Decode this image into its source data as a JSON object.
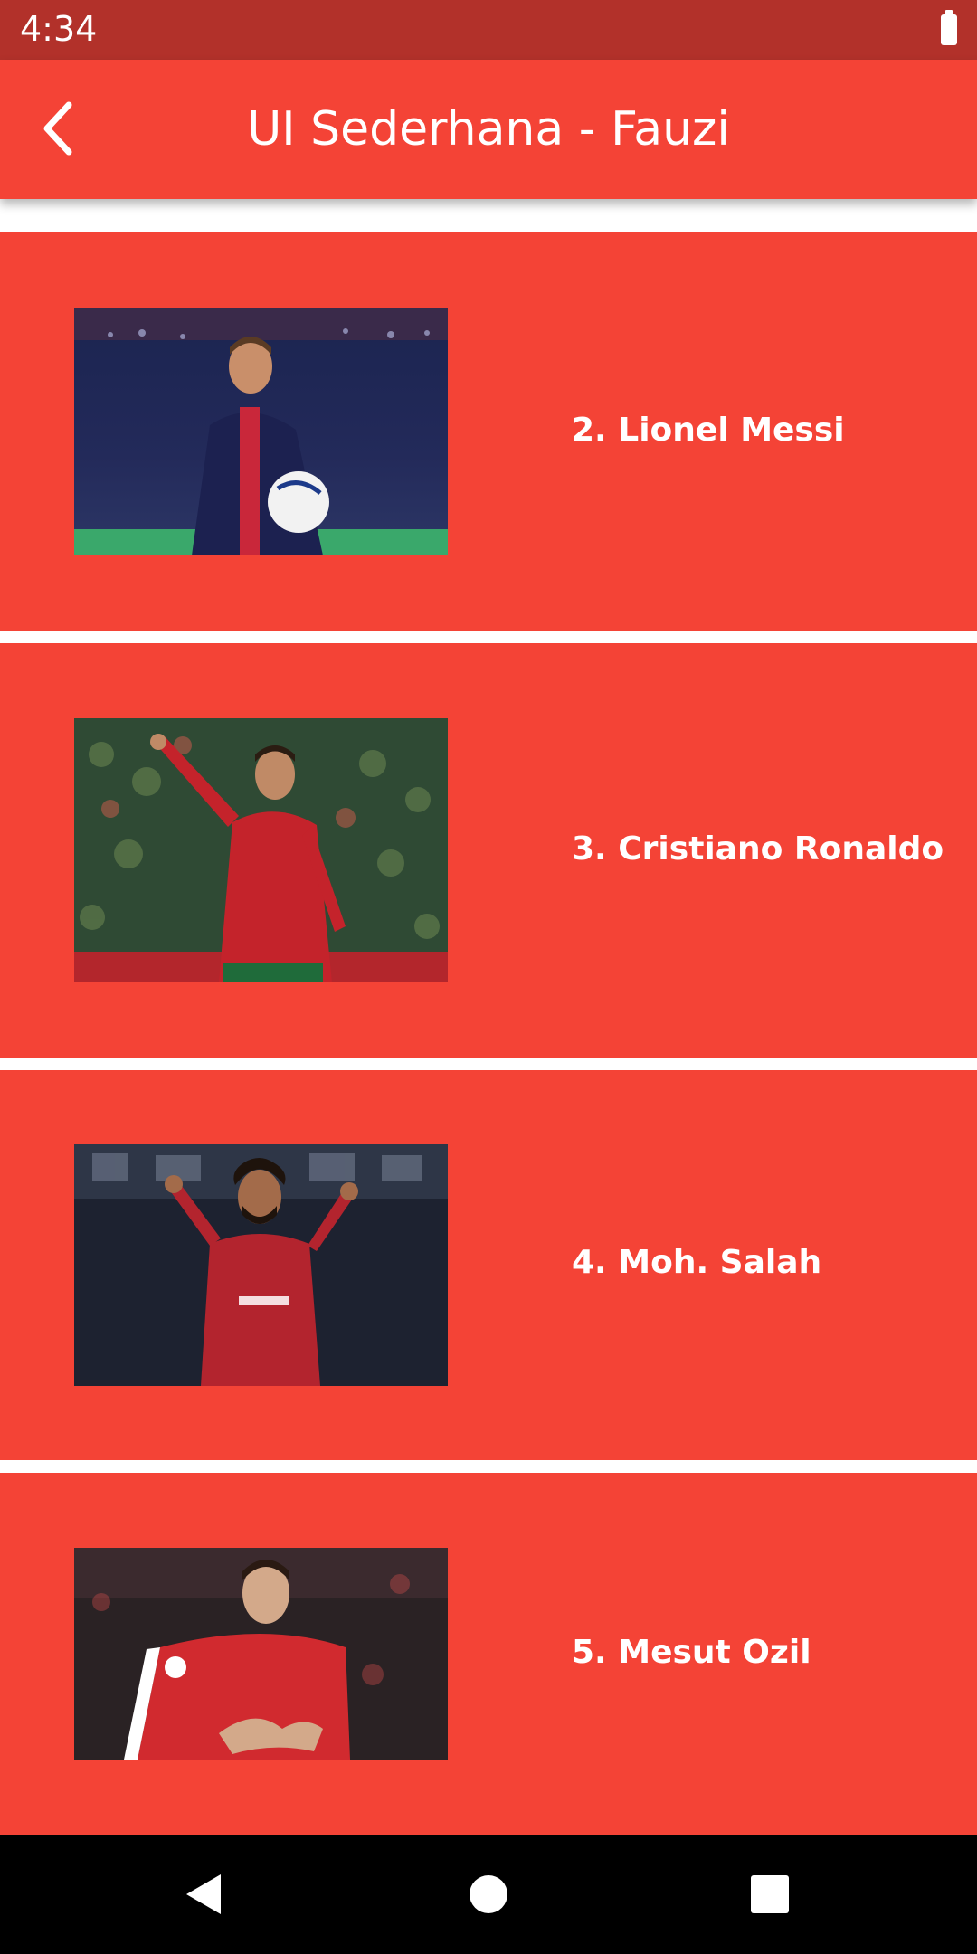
{
  "status_bar": {
    "time": "4:34",
    "battery_icon": "battery-full-icon"
  },
  "app_bar": {
    "title": "UI Sederhana - Fauzi",
    "back_icon": "chevron-left-icon"
  },
  "players": [
    {
      "label": "2. Lionel Messi",
      "photo_icon": "player-photo"
    },
    {
      "label": "3. Cristiano Ronaldo",
      "photo_icon": "player-photo"
    },
    {
      "label": "4. Moh. Salah",
      "photo_icon": "player-photo"
    },
    {
      "label": "5. Mesut Ozil",
      "photo_icon": "player-photo"
    }
  ],
  "nav_bar": {
    "back_icon": "triangle-back-icon",
    "home_icon": "circle-home-icon",
    "recents_icon": "square-recents-icon"
  },
  "colors": {
    "primary": "#f44336",
    "primary_dark": "#b2312a",
    "text": "#ffffff"
  }
}
